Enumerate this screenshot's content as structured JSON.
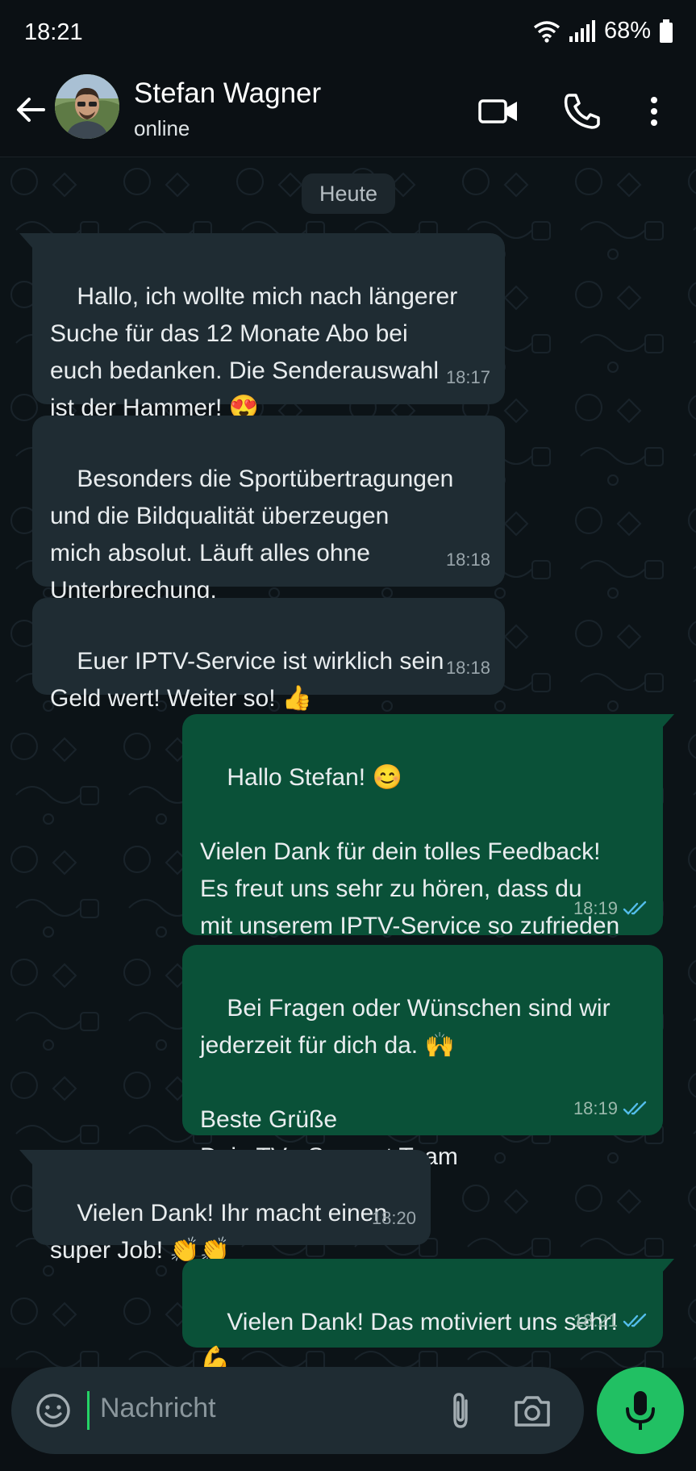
{
  "status_bar": {
    "time": "18:21",
    "battery": "68%"
  },
  "header": {
    "contact_name": "Stefan Wagner",
    "contact_status": "online"
  },
  "chat": {
    "date_label": "Heute",
    "messages": [
      {
        "dir": "in",
        "text": "Hallo, ich wollte mich nach längerer\nSuche für das 12 Monate Abo bei\neuch bedanken. Die Senderauswahl\nist der Hammer! 😍",
        "time": "18:17"
      },
      {
        "dir": "in",
        "text": "Besonders die Sportübertragungen\nund die Bildqualität überzeugen\nmich absolut. Läuft alles ohne\nUnterbrechung.",
        "time": "18:18"
      },
      {
        "dir": "in",
        "text": "Euer IPTV-Service ist wirklich sein\nGeld wert! Weiter so! 👍",
        "time": "18:18"
      },
      {
        "dir": "out",
        "text": "Hallo Stefan! 😊\n\nVielen Dank für dein tolles Feedback!\nEs freut uns sehr zu hören, dass du\nmit unserem IPTV-Service so zufrieden\nbist.",
        "time": "18:19"
      },
      {
        "dir": "out",
        "text": "Bei Fragen oder Wünschen sind wir\njederzeit für dich da. 🙌\n\nBeste Grüße\nDein TV+ Support Team",
        "time": "18:19"
      },
      {
        "dir": "in",
        "text": "Vielen Dank! Ihr macht einen\nsuper Job! 👏👏",
        "time": "18:20"
      },
      {
        "dir": "out",
        "text": "Vielen Dank! Das motiviert uns sehr! 💪",
        "time": "18:21"
      }
    ]
  },
  "composer": {
    "placeholder": "Nachricht"
  },
  "icons": {
    "back": "arrow-left-icon",
    "video": "video-call-icon",
    "call": "phone-icon",
    "menu": "more-vertical-icon",
    "emoji": "emoji-icon",
    "attach": "paperclip-icon",
    "camera": "camera-icon",
    "mic": "microphone-icon",
    "read": "double-check-icon"
  },
  "colors": {
    "incoming_bubble": "#1f2c33",
    "outgoing_bubble": "#0a5138",
    "accent": "#21c063",
    "read_ticks": "#53bdeb"
  }
}
